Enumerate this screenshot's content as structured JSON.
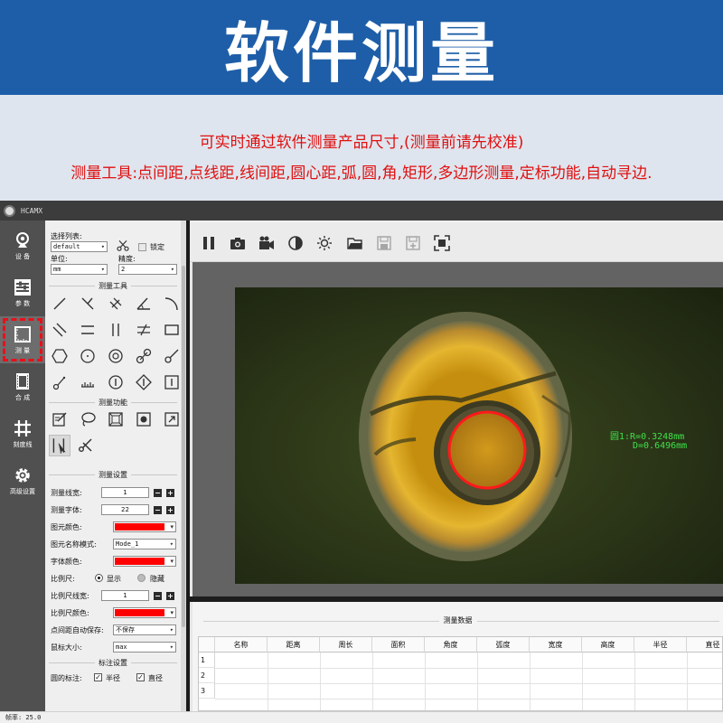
{
  "banner": {
    "title": "软件测量",
    "line1": "可实时通过软件测量产品尺寸,(测量前请先校准)",
    "line2": "测量工具:点间距,点线距,线间距,圆心距,弧,圆,角,矩形,多边形测量,定标功能,自动寻边."
  },
  "colors": {
    "banner": "#1e5ea8",
    "desc_text": "#e01010",
    "accent_red": "#ff0000",
    "measure_text": "#3fe04a"
  },
  "app": {
    "name": "HCAMX"
  },
  "nav": {
    "items": [
      {
        "label": "设 备",
        "icon": "webcam-icon"
      },
      {
        "label": "参 数",
        "icon": "sliders-icon"
      },
      {
        "label": "测 量",
        "icon": "ruler-icon"
      },
      {
        "label": "合 成",
        "icon": "film-icon"
      },
      {
        "label": "刻度线",
        "icon": "grid-icon"
      },
      {
        "label": "高级设置",
        "icon": "gear-icon"
      }
    ]
  },
  "panel": {
    "list_label": "选择列表:",
    "list_value": "default",
    "lock_label": "锁定",
    "unit_label": "单位:",
    "unit_value": "mm",
    "precision_label": "精度:",
    "precision_value": "2",
    "tools_title": "测量工具",
    "functions_title": "测量功能",
    "settings_title": "测量设置",
    "line_width_label": "测量线宽:",
    "line_width_value": "1",
    "font_label": "测量字体:",
    "font_value": "22",
    "element_color_label": "图元颜色:",
    "element_name_mode_label": "图元名称模式:",
    "element_name_mode_value": "Mode_1",
    "font_color_label": "字体颜色:",
    "scale_label": "比例尺:",
    "scale_show": "显示",
    "scale_hide": "隐藏",
    "scale_width_label": "比例尺线宽:",
    "scale_width_value": "1",
    "scale_color_label": "比例尺颜色:",
    "autosave_label": "点间距自动保存:",
    "autosave_value": "不保存",
    "cursor_label": "鼠标大小:",
    "cursor_value": "max",
    "annotation_title": "标注设置",
    "circle_annot_label": "圆的标注:",
    "radius_label": "半径",
    "diameter_label": "直径"
  },
  "measurement": {
    "line1": "圆1:R=0.3248mm",
    "line2": "D=0.6496mm"
  },
  "data_table": {
    "title": "测量数据",
    "columns": [
      "名称",
      "距离",
      "周长",
      "面积",
      "角度",
      "弧度",
      "宽度",
      "高度",
      "半径",
      "直径"
    ],
    "rows": [
      "1",
      "2",
      "3"
    ]
  },
  "status": {
    "text": "帧率: 25.0"
  }
}
